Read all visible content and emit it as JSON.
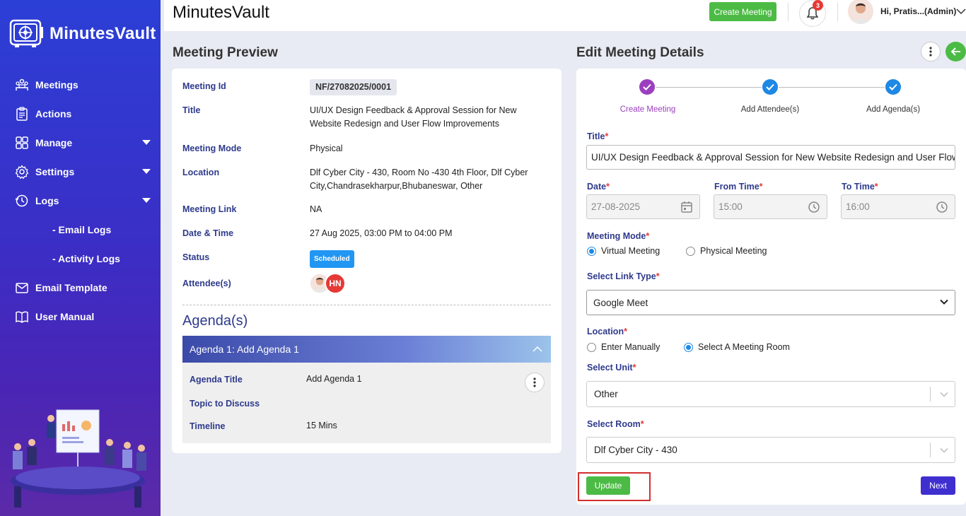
{
  "sidebar": {
    "brand": "MinutesVault",
    "items": [
      {
        "label": "Meetings",
        "icon": "meetings-icon"
      },
      {
        "label": "Actions",
        "icon": "actions-icon"
      },
      {
        "label": "Manage",
        "icon": "manage-icon",
        "expandable": true
      },
      {
        "label": "Settings",
        "icon": "gear-icon",
        "expandable": true
      },
      {
        "label": "Logs",
        "icon": "clock-icon",
        "expandable": true
      },
      {
        "label": "- Email Logs",
        "sub": true
      },
      {
        "label": "- Activity Logs",
        "sub": true
      },
      {
        "label": "Email Template",
        "icon": "envelope-icon"
      },
      {
        "label": "User Manual",
        "icon": "book-icon"
      }
    ]
  },
  "header": {
    "title": "MinutesVault",
    "create_meeting": "Create Meeting",
    "notification_count": "3",
    "user_name": "Hi, Pratis...(Admin)"
  },
  "preview": {
    "section_title": "Meeting Preview",
    "rows": [
      {
        "label": "Meeting Id",
        "value": "NF/27082025/0001"
      },
      {
        "label": "Title",
        "value": "UI/UX Design Feedback & Approval Session for New Website Redesign and User Flow Improvements"
      },
      {
        "label": "Meeting Mode",
        "value": "Physical"
      },
      {
        "label": "Location",
        "value": "Dlf Cyber City - 430, Room No -430 4th Floor, Dlf Cyber City,Chandrasekharpur,Bhubaneswar, Other"
      },
      {
        "label": "Meeting Link",
        "value": "NA"
      },
      {
        "label": "Date & Time",
        "value": "27 Aug 2025, 03:00 PM to 04:00 PM"
      },
      {
        "label": "Status",
        "value": "Scheduled"
      },
      {
        "label": "Attendee(s)",
        "value": ""
      }
    ],
    "attendee_initials": "HN",
    "agenda_heading": "Agenda(s)",
    "agenda": {
      "header": "Agenda 1: Add Agenda 1",
      "title_label": "Agenda Title",
      "title_value": "Add Agenda 1",
      "topic_label": "Topic to Discuss",
      "timeline_label": "Timeline",
      "timeline_value": "15 Mins"
    }
  },
  "edit": {
    "section_title": "Edit Meeting Details",
    "steps": [
      "Create Meeting",
      "Add Attendee(s)",
      "Add Agenda(s)"
    ],
    "title_label": "Title",
    "title_value": "UI/UX Design Feedback & Approval Session for New Website Redesign and User Flow Improvements",
    "date_label": "Date",
    "date_value": "27-08-2025",
    "from_label": "From Time",
    "from_value": "15:00",
    "to_label": "To Time",
    "to_value": "16:00",
    "mode_label": "Meeting Mode",
    "mode_options": [
      "Virtual Meeting",
      "Physical Meeting"
    ],
    "link_type_label": "Select Link Type",
    "link_type_value": "Google Meet",
    "location_label": "Location",
    "location_options": [
      "Enter Manually",
      "Select A Meeting Room"
    ],
    "unit_label": "Select Unit",
    "unit_value": "Other",
    "room_label": "Select Room",
    "room_value": "Dlf Cyber City - 430",
    "update_label": "Update",
    "next_label": "Next"
  }
}
